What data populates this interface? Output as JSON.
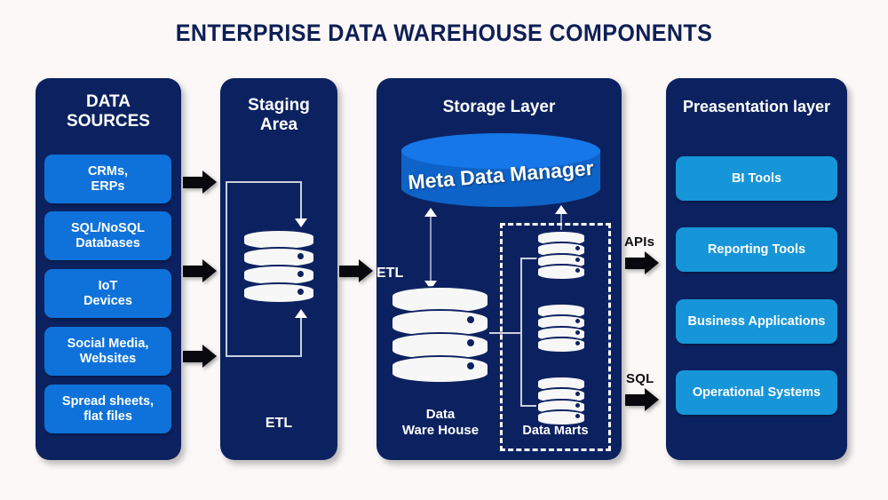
{
  "page": {
    "title": "ENTERPRISE DATA WAREHOUSE COMPONENTS",
    "background_color": "#fbf8f7",
    "panel_color": "#0c2260",
    "source_chip_color": "#0f72da",
    "presentation_chip_color": "#1795d9",
    "meta_cylinder_color": "#1577e8"
  },
  "panels": {
    "data_sources": {
      "title": "DATA\nSOURCES",
      "title_line1": "DATA",
      "title_line2": "SOURCES",
      "items": [
        {
          "line1": "CRMs,",
          "line2": "ERPs"
        },
        {
          "line1": "SQL/NoSQL",
          "line2": "Databases"
        },
        {
          "line1": "IoT",
          "line2": "Devices"
        },
        {
          "line1": "Social Media,",
          "line2": "Websites"
        },
        {
          "line1": "Spread sheets,",
          "line2": "flat files"
        }
      ]
    },
    "staging_area": {
      "title_line1": "Staging",
      "title_line2": "Area",
      "bottom_label": "ETL"
    },
    "storage_layer": {
      "title": "Storage Layer",
      "etl_label": "ETL",
      "meta_data_manager": "Meta Data Manager",
      "warehouse_line1": "Data",
      "warehouse_line2": "Ware House",
      "data_marts_label": "Data Marts"
    },
    "presentation_layer": {
      "title": "Preasentation layer",
      "items": [
        {
          "label": "BI Tools"
        },
        {
          "label": "Reporting Tools"
        },
        {
          "label": "Business Applications"
        },
        {
          "label": "Operational Systems"
        }
      ]
    }
  },
  "flows": {
    "apis_label": "APIs",
    "sql_label": "SQL"
  }
}
